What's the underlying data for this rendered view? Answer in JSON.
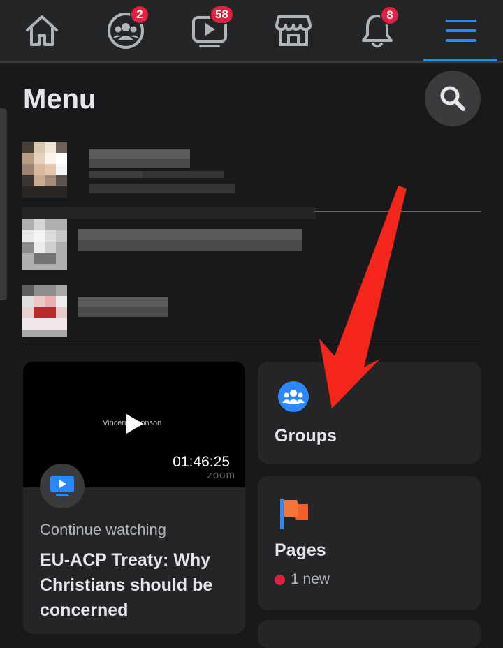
{
  "nav": {
    "badges": {
      "friends": "2",
      "watch": "58",
      "notifications": "8"
    },
    "active_tab": "menu"
  },
  "menu": {
    "title": "Menu",
    "search_icon": "search-icon"
  },
  "cards": {
    "video": {
      "duration": "01:46:25",
      "watermark": "zoom",
      "continue_label": "Continue watching",
      "title": "EU-ACP Treaty: Why Christians should be concerned"
    },
    "groups": {
      "label": "Groups",
      "icon": "groups-icon"
    },
    "pages": {
      "label": "Pages",
      "new_text": "1 new",
      "icon": "flag-icon"
    }
  },
  "colors": {
    "accent": "#2d88ff",
    "badge": "#e41e3f",
    "background": "#18191a",
    "card": "#242526",
    "annotation_arrow": "#f4261b"
  }
}
